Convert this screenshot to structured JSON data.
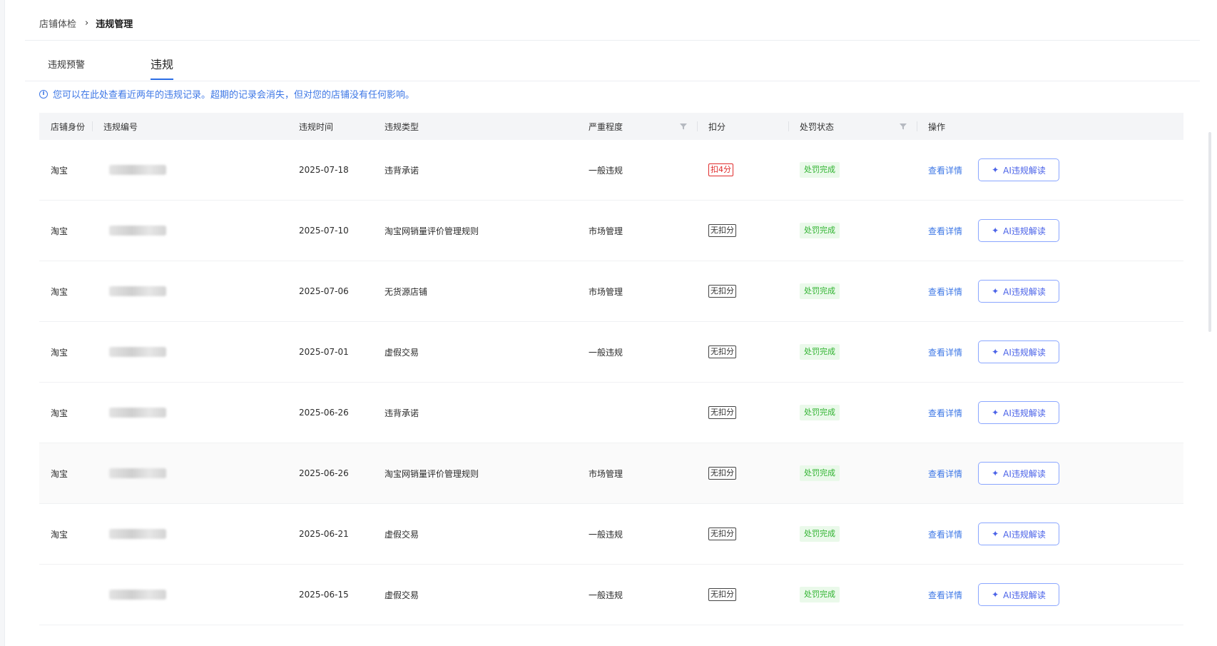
{
  "breadcrumb": {
    "parent": "店铺体检",
    "current": "违规管理"
  },
  "tabs": [
    {
      "label": "违规预警",
      "active": false
    },
    {
      "label": "违规",
      "active": true
    }
  ],
  "notice": {
    "text": "您可以在此处查看近两年的违规记录。超期的记录会消失，但对您的店铺没有任何影响。"
  },
  "table": {
    "headers": {
      "shop_identity": "店铺身份",
      "violation_id": "违规编号",
      "violation_time": "违规时间",
      "violation_type": "违规类型",
      "severity": "严重程度",
      "deduction": "扣分",
      "penalty_status": "处罚状态",
      "actions": "操作"
    },
    "rows": [
      {
        "shop": "淘宝",
        "date": "2025-07-18",
        "type": "违背承诺",
        "severity": "一般违规",
        "deduction": "扣4分",
        "deduction_kind": "red",
        "status": "处罚完成",
        "detail": "查看详情",
        "ai": "AI违规解读"
      },
      {
        "shop": "淘宝",
        "date": "2025-07-10",
        "type": "淘宝网销量评价管理规则",
        "severity": "市场管理",
        "deduction": "无扣分",
        "deduction_kind": "gray",
        "status": "处罚完成",
        "detail": "查看详情",
        "ai": "AI违规解读"
      },
      {
        "shop": "淘宝",
        "date": "2025-07-06",
        "type": "无货源店铺",
        "severity": "市场管理",
        "deduction": "无扣分",
        "deduction_kind": "gray",
        "status": "处罚完成",
        "detail": "查看详情",
        "ai": "AI违规解读"
      },
      {
        "shop": "淘宝",
        "date": "2025-07-01",
        "type": "虚假交易",
        "severity": "一般违规",
        "deduction": "无扣分",
        "deduction_kind": "gray",
        "status": "处罚完成",
        "detail": "查看详情",
        "ai": "AI违规解读"
      },
      {
        "shop": "淘宝",
        "date": "2025-06-26",
        "type": "违背承诺",
        "severity": "",
        "deduction": "无扣分",
        "deduction_kind": "gray",
        "status": "处罚完成",
        "detail": "查看详情",
        "ai": "AI违规解读"
      },
      {
        "shop": "淘宝",
        "date": "2025-06-26",
        "type": "淘宝网销量评价管理规则",
        "severity": "市场管理",
        "deduction": "无扣分",
        "deduction_kind": "gray",
        "status": "处罚完成",
        "detail": "查看详情",
        "ai": "AI违规解读"
      },
      {
        "shop": "淘宝",
        "date": "2025-06-21",
        "type": "虚假交易",
        "severity": "一般违规",
        "deduction": "无扣分",
        "deduction_kind": "gray",
        "status": "处罚完成",
        "detail": "查看详情",
        "ai": "AI违规解读"
      },
      {
        "shop": "",
        "date": "2025-06-15",
        "type": "虚假交易",
        "severity": "一般违规",
        "deduction": "无扣分",
        "deduction_kind": "gray",
        "status": "处罚完成",
        "detail": "查看详情",
        "ai": "AI违规解读"
      }
    ]
  },
  "icons": {
    "breadcrumb_separator": "chevron-right-icon",
    "notice": "info-icon",
    "filter": "filter-icon",
    "ai": "sparkle-icon"
  },
  "colors": {
    "accent_blue": "#3d77e6",
    "deduction_red": "#e02b2b",
    "status_green": "#2fb32f",
    "status_green_bg": "#eaf9ea",
    "ai_button_border": "#8aa6ff"
  }
}
